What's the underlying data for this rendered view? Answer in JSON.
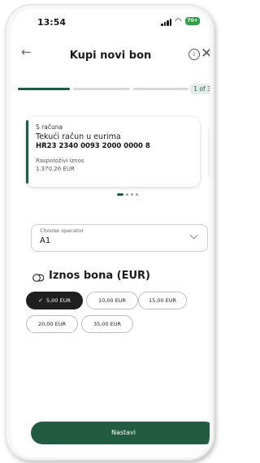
{
  "status_bar": {
    "time": "13:54",
    "battery": "70+"
  },
  "header": {
    "title": "Kupi novi bon",
    "back_icon": "arrow-left-icon",
    "info_icon": "info-circle-icon",
    "close_icon": "close-icon"
  },
  "progress": {
    "step_label": "1 of 3",
    "current_step": 1,
    "total_steps": 3
  },
  "account_card": {
    "from_label": "S računa",
    "account_name": "Tekući račun u eurima",
    "iban": "HR23 2340 0093 2000 0000 8",
    "available_label": "Raspoloživi iznos",
    "available_amount": "1.370,26 EUR"
  },
  "carousel": {
    "count": 4,
    "active_index": 0
  },
  "operator": {
    "label": "Choose operator",
    "value": "A1"
  },
  "amount_section": {
    "title": "Iznos bona (EUR)",
    "icon": "coins-icon"
  },
  "amounts": [
    {
      "label": "5,00 EUR",
      "selected": true
    },
    {
      "label": "10,00 EUR",
      "selected": false
    },
    {
      "label": "15,00 EUR",
      "selected": false
    },
    {
      "label": "20,00 EUR",
      "selected": false
    },
    {
      "label": "35,00 EUR",
      "selected": false
    }
  ],
  "cta": {
    "label": "Nastavi"
  },
  "colors": {
    "brand": "#215b42",
    "chip_selected": "#1f1f1f"
  }
}
